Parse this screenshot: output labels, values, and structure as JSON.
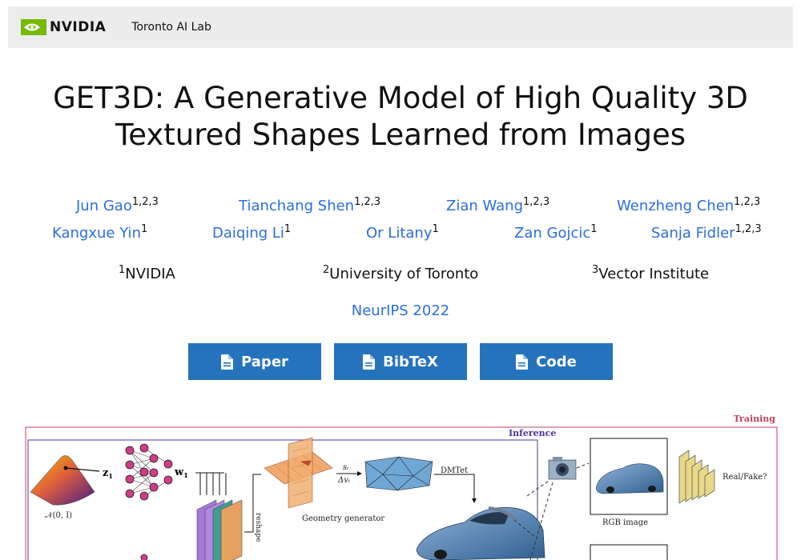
{
  "navbar": {
    "logo_text": "NVIDIA",
    "lab_label": "Toronto AI Lab"
  },
  "title": "GET3D: A Generative Model of High Quality 3D Textured Shapes Learned from Images",
  "authors": [
    {
      "name": "Jun Gao",
      "aff": "1,2,3"
    },
    {
      "name": "Tianchang Shen",
      "aff": "1,2,3"
    },
    {
      "name": "Zian Wang",
      "aff": "1,2,3"
    },
    {
      "name": "Wenzheng Chen",
      "aff": "1,2,3"
    },
    {
      "name": "Kangxue Yin",
      "aff": "1"
    },
    {
      "name": "Daiqing Li",
      "aff": "1"
    },
    {
      "name": "Or Litany",
      "aff": "1"
    },
    {
      "name": "Zan Gojcic",
      "aff": "1"
    },
    {
      "name": "Sanja Fidler",
      "aff": "1,2,3"
    }
  ],
  "affiliations": [
    {
      "num": "1",
      "name": "NVIDIA"
    },
    {
      "num": "2",
      "name": "University of Toronto"
    },
    {
      "num": "3",
      "name": "Vector Institute"
    }
  ],
  "venue": "NeurIPS 2022",
  "buttons": {
    "paper": "Paper",
    "bibtex": "BibTeX",
    "code": "Code"
  },
  "figure": {
    "training_label": "Training",
    "inference_label": "Inference",
    "z_label": "z",
    "z_sub": "1",
    "w_label": "w",
    "w_sub": "1",
    "normal_label": "𝒩(0, I)",
    "reshape_label": "reshape",
    "geometry_label": "Geometry generator",
    "si_label": "sᵢ",
    "dv_label": "Δvᵢ",
    "dmtet_label": "DMTet",
    "rgb_label": "RGB image",
    "real_fake_label": "Real/Fake?"
  },
  "colors": {
    "link": "#2a6fdb",
    "button": "#2573bd",
    "nvidia_green": "#76b900",
    "training": "#c04060",
    "inference": "#5030a0"
  }
}
